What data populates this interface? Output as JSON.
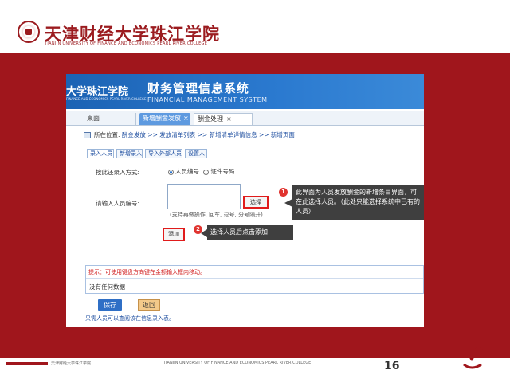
{
  "slide": {
    "school_name": "天津财经大学珠江学院",
    "school_sub": "TIANJIN UNIVERSITY OF FINANCE AND ECONOMICS PEARL RIVER COLLEGE",
    "page_number": "16",
    "footer_left": "天津财经大学珠江学院",
    "footer_mid": "TIANJIN UNIVERSITY OF FINANCE AND ECONOMICS PEARL RIVER COLLEGE",
    "accent_color": "#a0161c"
  },
  "app": {
    "logo_text": "大学珠江学院",
    "logo_sub": "FINANCE AND ECONOMICS PEARL RIVER COLLEGE",
    "title": "财务管理信息系统",
    "subtitle": "FINANCIAL MANAGEMENT SYSTEM"
  },
  "tabs": [
    {
      "label": "桌面"
    },
    {
      "label": "新增酬金发放",
      "close": "×"
    },
    {
      "label": "酬金处理",
      "close": "×"
    }
  ],
  "location": {
    "label": "所在位置:",
    "trail": "酬金发放 >> 发放清单列表 >> 新增清单详情信息 >> 新增页面"
  },
  "inner_tabs": [
    "录入人员",
    "新增录入",
    "导入外部人员",
    "设置人"
  ],
  "form": {
    "entry_method_label": "按此还录入方式:",
    "radio_staff": "人员编号",
    "radio_id": "证件号码",
    "id_label": "请输入人员编号:",
    "hint": "(支持再做操作, 回车, 逗号, 分号隔开)",
    "select_button": "选择",
    "add_button": "添加"
  },
  "callouts": [
    {
      "num": "1",
      "text": "此界面为人员发放酬金的新增条目界面，可在此选择人员。（此处只能选择系统中已有的人员）"
    },
    {
      "num": "2",
      "text": "选择人员后点击添加"
    }
  ],
  "notice": {
    "text": "提示：可使用键盘方向键在金额输入框内移动。",
    "empty": "没有任何数据"
  },
  "actions": {
    "save": "保存",
    "back": "返回"
  },
  "bottom_note": "只需人员可以查阅该在信息录入表。"
}
